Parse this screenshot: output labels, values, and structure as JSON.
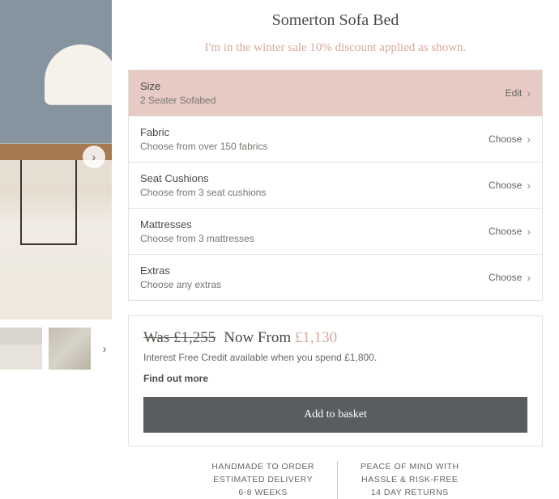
{
  "product": {
    "title": "Somerton Sofa Bed",
    "sale_message": "I'm in the winter sale 10% discount applied as shown."
  },
  "options": [
    {
      "label": "Size",
      "desc": "2 Seater Sofabed",
      "action": "Edit",
      "selected": true
    },
    {
      "label": "Fabric",
      "desc": "Choose from over 150 fabrics",
      "action": "Choose",
      "selected": false
    },
    {
      "label": "Seat Cushions",
      "desc": "Choose from 3 seat cushions",
      "action": "Choose",
      "selected": false
    },
    {
      "label": "Mattresses",
      "desc": "Choose from 3 mattresses",
      "action": "Choose",
      "selected": false
    },
    {
      "label": "Extras",
      "desc": "Choose any extras",
      "action": "Choose",
      "selected": false
    }
  ],
  "pricing": {
    "was_label": "Was £1,255",
    "now_label": "Now From",
    "now_price": "£1,130",
    "credit_text": "Interest Free Credit available when you spend £1,800.",
    "find_more": "Find out more",
    "add_button": "Add to basket"
  },
  "footer": {
    "left_line1": "HANDMADE TO ORDER",
    "left_line2": "ESTIMATED DELIVERY",
    "left_line3": "6-8 WEEKS",
    "right_line1": "PEACE OF MIND WITH",
    "right_line2": "HASSLE & RISK-FREE",
    "right_line3": "14 DAY RETURNS"
  }
}
